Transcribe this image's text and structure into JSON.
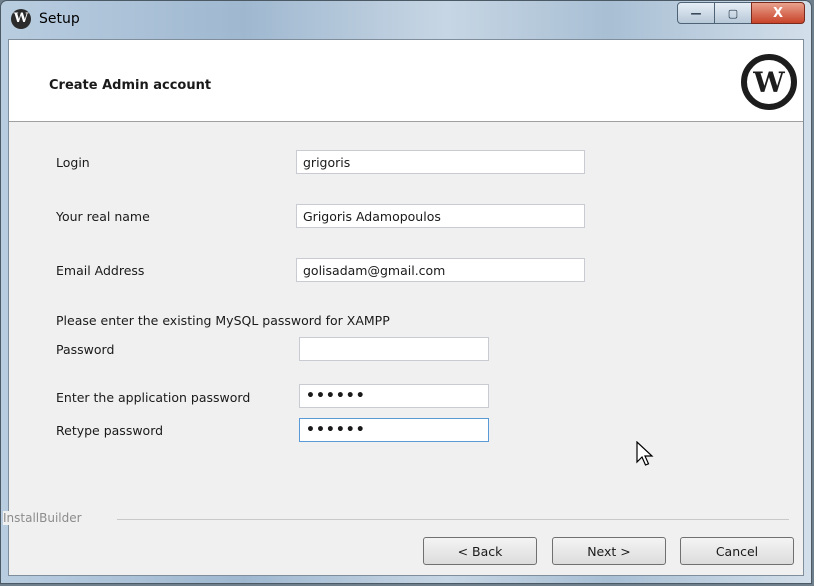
{
  "window": {
    "title": "Setup",
    "app_icon": "wordpress-icon"
  },
  "title_controls": {
    "minimize": "—",
    "maximize": "▢",
    "close": "X"
  },
  "header": {
    "title": "Create Admin account",
    "logo_letter": "W"
  },
  "form": {
    "login": {
      "label": "Login",
      "value": "grigoris"
    },
    "real_name": {
      "label": "Your real name",
      "value": "Grigoris Adamopoulos"
    },
    "email": {
      "label": "Email Address",
      "value": "golisadam@gmail.com"
    },
    "mysql_note": "Please enter the existing MySQL password for XAMPP",
    "mysql_password": {
      "label": "Password",
      "value": ""
    },
    "app_password": {
      "label": "Enter the application password",
      "value": "••••••"
    },
    "retype_password": {
      "label": "Retype password",
      "value": "••••••"
    }
  },
  "footer": {
    "brand": "InstallBuilder",
    "back": "< Back",
    "next": "Next >",
    "cancel": "Cancel"
  }
}
